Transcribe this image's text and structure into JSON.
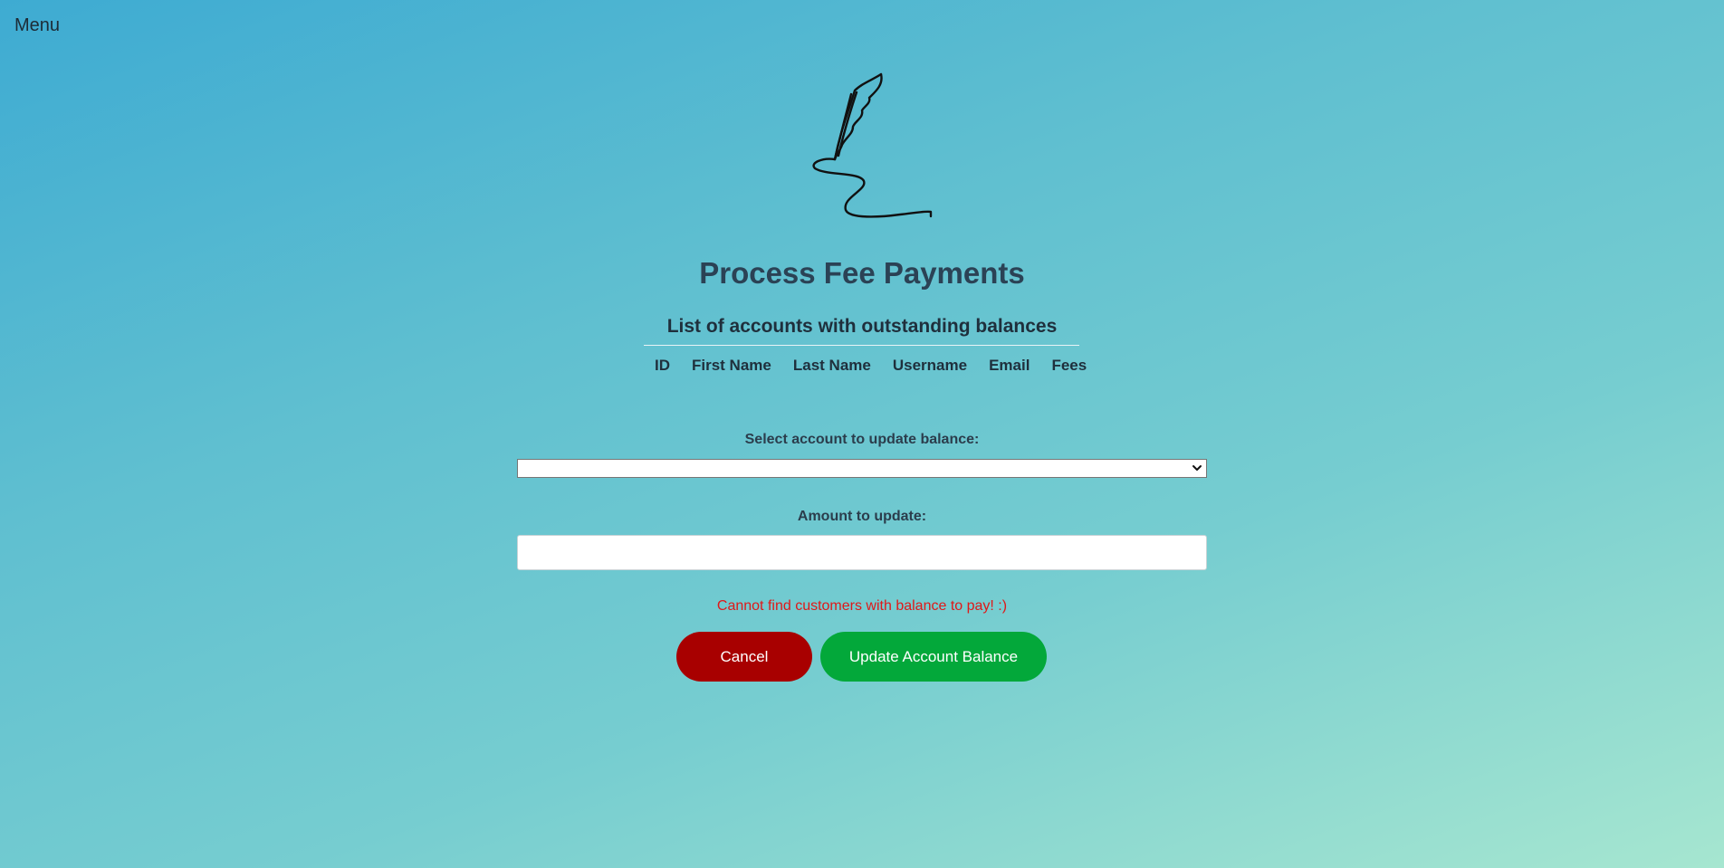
{
  "nav": {
    "menu_label": "Menu"
  },
  "logo": {
    "icon": "quill-pen-signature-icon"
  },
  "page": {
    "title": "Process Fee Payments"
  },
  "accounts_table": {
    "caption": "List of accounts with outstanding balances",
    "columns": [
      "ID",
      "First Name",
      "Last Name",
      "Username",
      "Email",
      "Fees"
    ],
    "rows": []
  },
  "form": {
    "select_label": "Select account to update balance:",
    "select_value": "",
    "amount_label": "Amount to update:",
    "amount_value": "",
    "amount_placeholder": ""
  },
  "status": {
    "error_message": "Cannot find customers with balance to pay! :)"
  },
  "actions": {
    "cancel_label": "Cancel",
    "update_label": "Update Account Balance"
  },
  "colors": {
    "cancel_button": "#a80000",
    "update_button": "#03a83a",
    "error_text": "#e01818",
    "title_text": "#2b4255"
  }
}
